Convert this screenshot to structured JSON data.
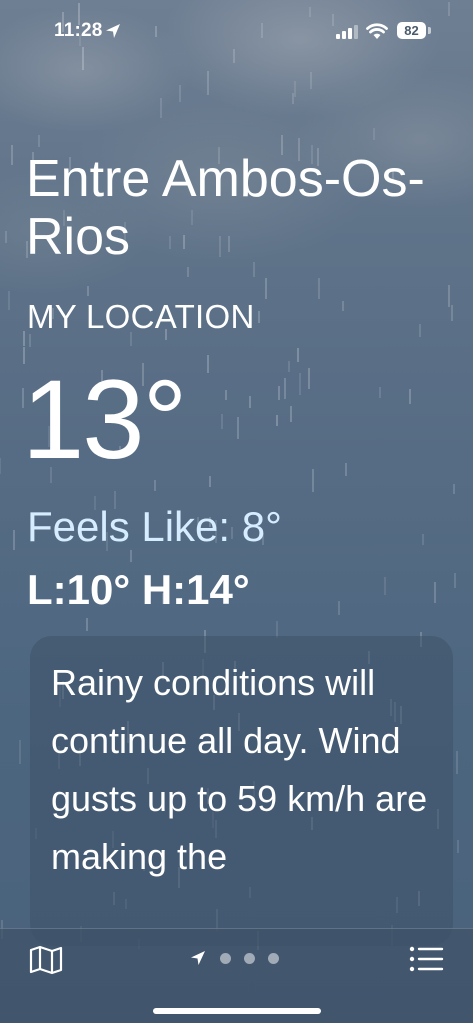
{
  "status_bar": {
    "time": "11:28",
    "battery": "82",
    "icons": [
      "location-arrow-icon",
      "cellular-signal-icon",
      "wifi-icon",
      "battery-icon"
    ]
  },
  "location": {
    "city": "Entre Ambos-Os-Rios",
    "label": "MY LOCATION"
  },
  "weather": {
    "temperature": "13°",
    "feels_like": "Feels Like: 8°",
    "low_high": "L:10° H:14°",
    "summary": "Rainy conditions will continue all day. Wind gusts up to 59 km/h are making the"
  },
  "bottom_bar": {
    "icons": [
      "map-icon",
      "location-arrow-icon",
      "list-icon"
    ],
    "page_count": 4,
    "active_page": 1
  },
  "colors": {
    "background": "#566c84",
    "feels_like_text": "#d6ecff",
    "card": "#3e5268"
  }
}
